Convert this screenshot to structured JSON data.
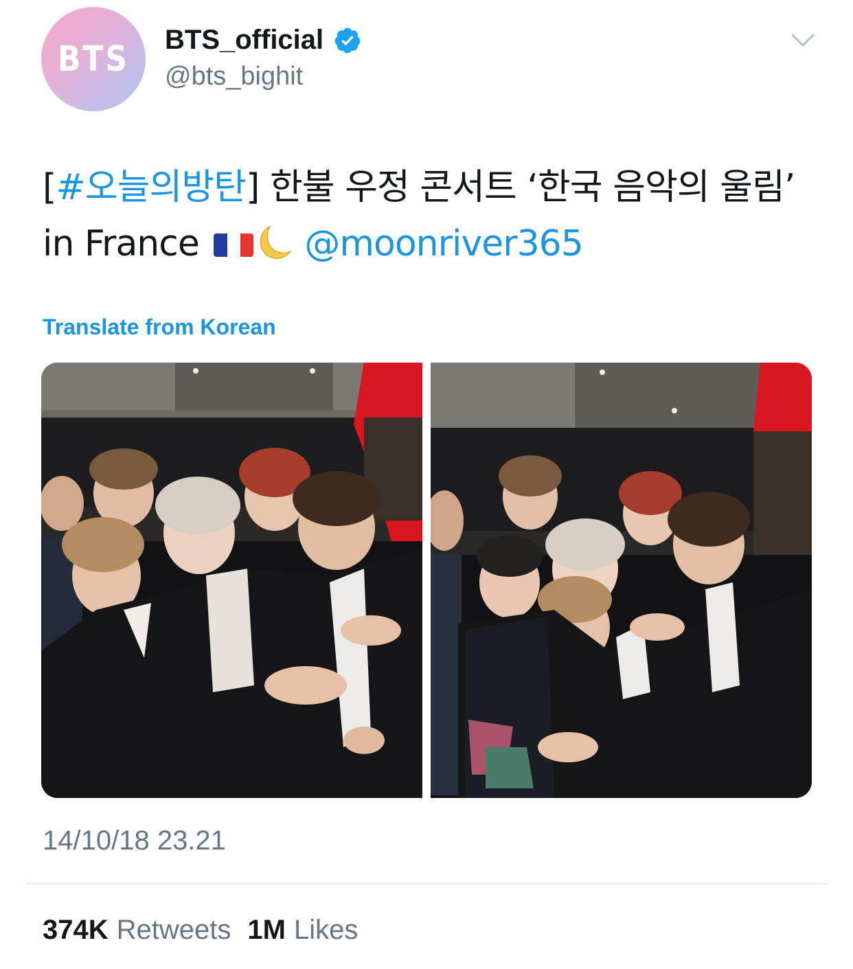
{
  "header": {
    "avatar_text": "BTS",
    "display_name": "BTS_official",
    "handle": "@bts_bighit"
  },
  "tweet": {
    "hashtag_open": "[",
    "hashtag": "#오늘의방탄",
    "text_main": "] 한불 우정 콘서트 ‘한국 음악의 울림’ in France",
    "emoji_flag": "france-flag",
    "emoji_moon": "crescent-moon",
    "mention": "@moonriver365",
    "translate_label": "Translate from Korean"
  },
  "media": {
    "photos": [
      "group-selfie-photo-1",
      "group-selfie-photo-2"
    ]
  },
  "meta": {
    "timestamp": "14/10/18 23.21"
  },
  "stats": {
    "retweets_count": "374K",
    "retweets_label": "Retweets",
    "likes_count": "1M",
    "likes_label": "Likes"
  },
  "colors": {
    "link_blue": "#1b95e0",
    "secondary_gray": "#657786",
    "verified_blue": "#1da1f2",
    "divider": "#e1e8ed"
  }
}
